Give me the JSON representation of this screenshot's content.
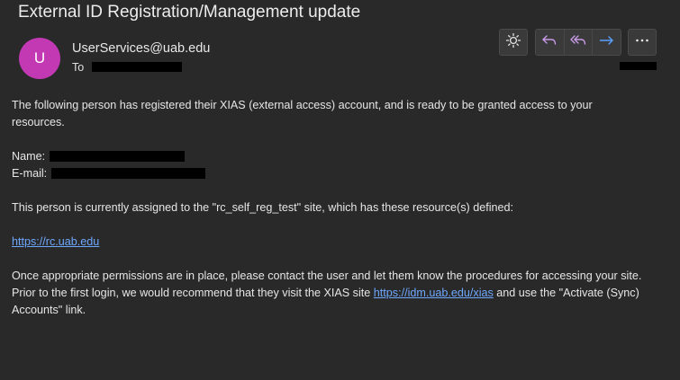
{
  "email": {
    "subject": "External ID Registration/Management update",
    "avatar_initial": "U",
    "sender": "UserServices@uab.edu",
    "to_label": "To"
  },
  "toolbar": {
    "icons": [
      "sun-icon",
      "reply-icon",
      "reply-all-icon",
      "forward-icon",
      "more-icon"
    ],
    "accent_color": "#c79ae8",
    "forward_color": "#5aa0ff"
  },
  "body": {
    "intro": "The following person has registered their XIAS (external access) account, and is ready to be granted access to your resources.",
    "name_label": "Name:",
    "email_label": "E-mail:",
    "site_text": "This person is currently assigned to the \"rc_self_reg_test\" site, which has these resource(s) defined:",
    "resource_link": "https://rc.uab.edu",
    "closing_part1": "Once appropriate permissions are in place, please contact the user and let them know the procedures for accessing your site.  Prior to the first login, we would recommend that they visit the XIAS site ",
    "closing_link": "https://idm.uab.edu/xias",
    "closing_part2": " and use the \"Activate (Sync) Accounts\" link."
  }
}
